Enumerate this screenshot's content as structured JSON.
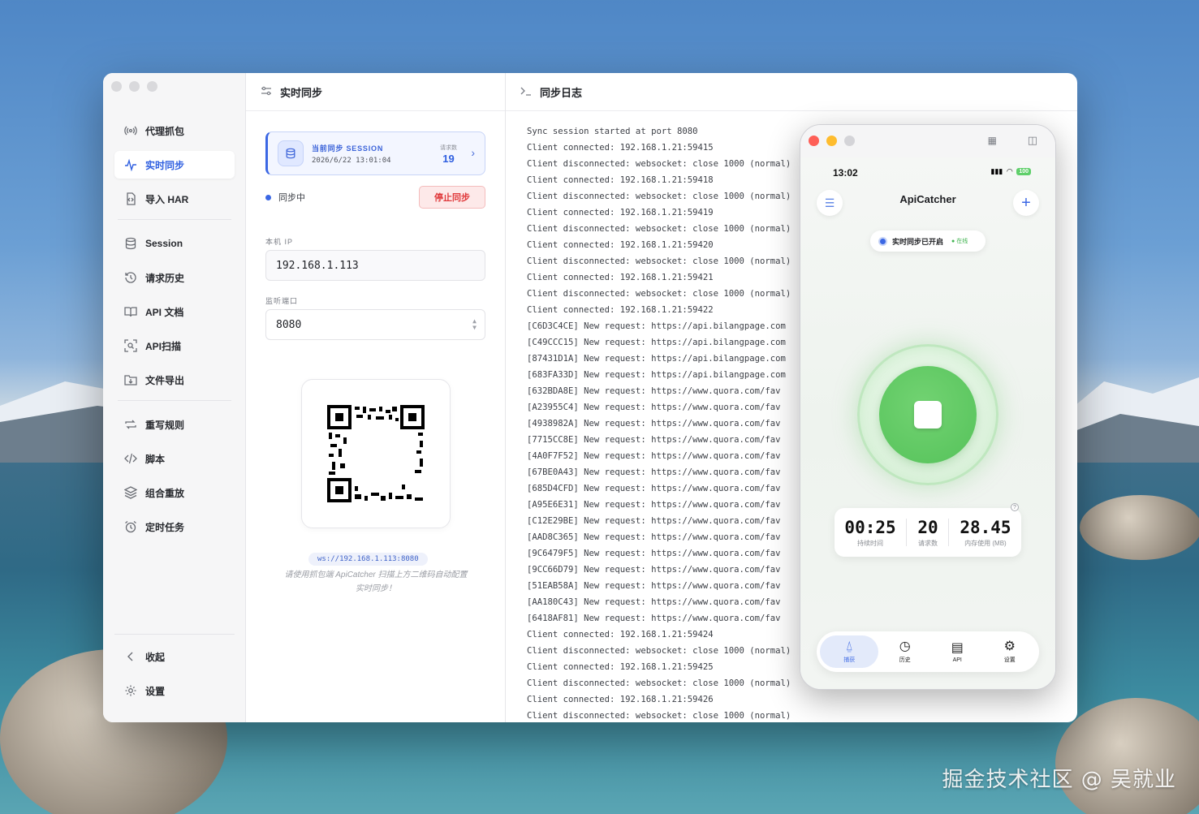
{
  "watermark": "掘金技术社区 @ 吴就业",
  "sidebar": {
    "items_group1": [
      {
        "label": "代理抓包",
        "icon": "broadcast-icon"
      },
      {
        "label": "实时同步",
        "icon": "pulse-icon",
        "active": true
      },
      {
        "label": "导入 HAR",
        "icon": "file-import-icon"
      }
    ],
    "items_group2": [
      {
        "label": "Session",
        "icon": "database-icon"
      },
      {
        "label": "请求历史",
        "icon": "history-icon"
      },
      {
        "label": "API 文档",
        "icon": "book-icon"
      },
      {
        "label": "API扫描",
        "icon": "scan-icon"
      },
      {
        "label": "文件导出",
        "icon": "export-icon"
      }
    ],
    "items_group3": [
      {
        "label": "重写规则",
        "icon": "rewrite-icon"
      },
      {
        "label": "脚本",
        "icon": "code-icon"
      },
      {
        "label": "组合重放",
        "icon": "layers-icon"
      },
      {
        "label": "定时任务",
        "icon": "alarm-icon"
      }
    ],
    "collapse_label": "收起",
    "settings_label": "设置"
  },
  "sync": {
    "title": "实时同步",
    "session_label": "当前同步 SESSION",
    "session_time": "2026/6/22 13:01:04",
    "request_count_label": "请求数",
    "request_count": "19",
    "status": "同步中",
    "stop_button": "停止同步",
    "ip_label": "本机 IP",
    "ip_value": "192.168.1.113",
    "port_label": "监听端口",
    "port_value": "8080",
    "ws_url": "ws://192.168.1.113:8080",
    "hint": "请使用抓包端 ApiCatcher 扫描上方二维码自动配置实时同步！"
  },
  "log": {
    "title": "同步日志",
    "lines": [
      "Sync session started at port 8080",
      "Client connected: 192.168.1.21:59415",
      "Client disconnected: websocket: close 1000 (normal)",
      "Client connected: 192.168.1.21:59418",
      "Client disconnected: websocket: close 1000 (normal)",
      "Client connected: 192.168.1.21:59419",
      "Client disconnected: websocket: close 1000 (normal)",
      "Client connected: 192.168.1.21:59420",
      "Client disconnected: websocket: close 1000 (normal)",
      "Client connected: 192.168.1.21:59421",
      "Client disconnected: websocket: close 1000 (normal)",
      "Client connected: 192.168.1.21:59422",
      "[C6D3C4CE] New request: https://api.bilangpage.com",
      "[C49CCC15] New request: https://api.bilangpage.com",
      "[87431D1A] New request: https://api.bilangpage.com",
      "[683FA33D] New request: https://api.bilangpage.com",
      "[632BDA8E] New request: https://www.quora.com/fav",
      "[A23955C4] New request: https://www.quora.com/fav",
      "[4938982A] New request: https://www.quora.com/fav",
      "[7715CC8E] New request: https://www.quora.com/fav",
      "[4A0F7F52] New request: https://www.quora.com/fav",
      "[67BE0A43] New request: https://www.quora.com/fav",
      "[685D4CFD] New request: https://www.quora.com/fav",
      "[A95E6E31] New request: https://www.quora.com/fav",
      "[C12E29BE] New request: https://www.quora.com/fav",
      "[AAD8C365] New request: https://www.quora.com/fav",
      "[9C6479F5] New request: https://www.quora.com/fav",
      "[9CC66D79] New request: https://www.quora.com/fav",
      "[51EAB58A] New request: https://www.quora.com/fav",
      "[AA180C43] New request: https://www.quora.com/fav",
      "[6418AF81] New request: https://www.quora.com/fav",
      "Client connected: 192.168.1.21:59424",
      "Client disconnected: websocket: close 1000 (normal)",
      "Client connected: 192.168.1.21:59425",
      "Client disconnected: websocket: close 1000 (normal)",
      "Client connected: 192.168.1.21:59426",
      "Client disconnected: websocket: close 1000 (normal)"
    ]
  },
  "phone": {
    "time": "13:02",
    "battery": "100",
    "app_title": "ApiCatcher",
    "sync_pill": "实时同步已开启",
    "online": "在线",
    "duration": "00:25",
    "duration_label": "持续时间",
    "requests": "20",
    "requests_label": "请求数",
    "memory": "28.45",
    "memory_label": "内存使用 (MB)",
    "tabs": [
      {
        "label": "捕获",
        "icon": "antenna-icon",
        "active": true
      },
      {
        "label": "历史",
        "icon": "clock-history-icon"
      },
      {
        "label": "API",
        "icon": "document-icon"
      },
      {
        "label": "设置",
        "icon": "gear-icon"
      }
    ]
  },
  "colors": {
    "accent": "#3b67e4",
    "stop": "#e0393b",
    "record_green": "#5cc761"
  }
}
